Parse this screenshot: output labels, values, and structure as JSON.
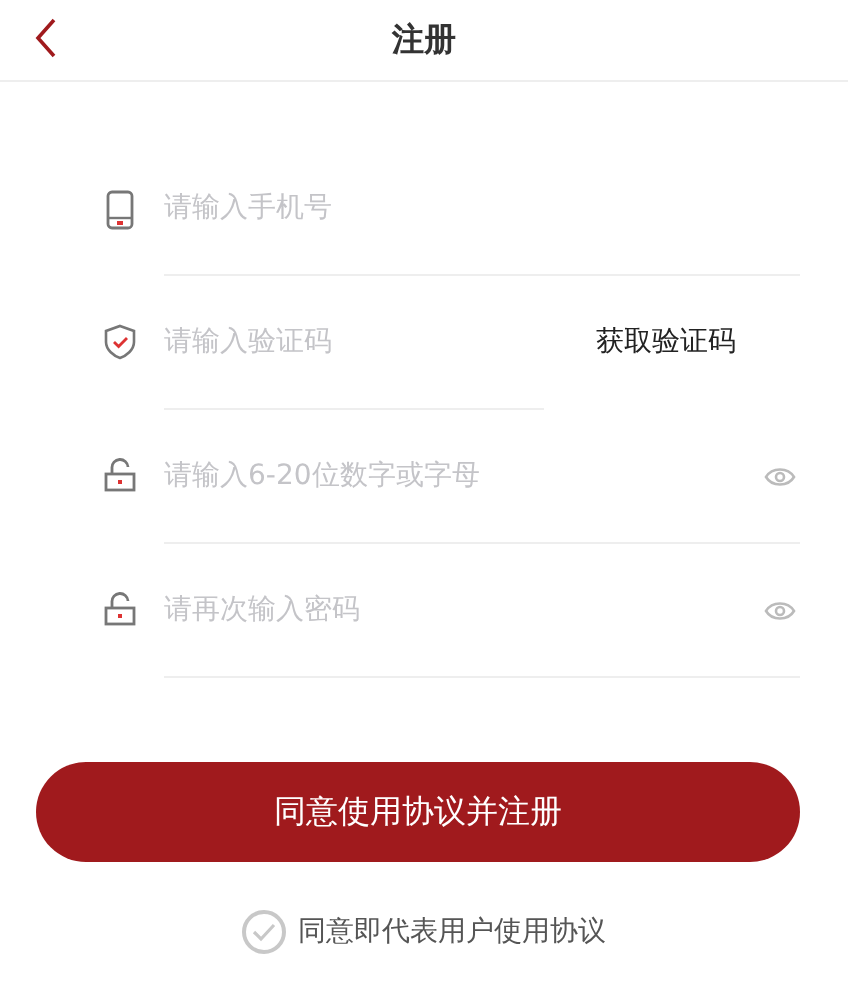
{
  "header": {
    "title": "注册"
  },
  "fields": [
    {
      "kind": "phone",
      "placeholder": "请输入手机号",
      "show_password_toggle": false
    },
    {
      "kind": "code",
      "placeholder": "请输入验证码",
      "action": "获取验证码",
      "show_password_toggle": false
    },
    {
      "kind": "lock",
      "placeholder": "请输入6-20位数字或字母",
      "show_password_toggle": true
    },
    {
      "kind": "lock",
      "placeholder": "请再次输入密码",
      "show_password_toggle": true
    }
  ],
  "submit": "同意使用协议并注册",
  "agreement": {
    "label": "同意即代表用户使用协议",
    "checked": false
  }
}
